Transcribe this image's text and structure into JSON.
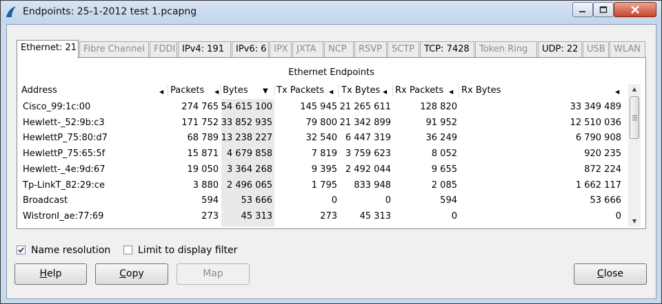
{
  "window": {
    "title": "Endpoints: 25-1-2012 test 1.pcapng"
  },
  "tabs": [
    {
      "label": "Ethernet: 21",
      "active": true,
      "enabled": true
    },
    {
      "label": "Fibre Channel",
      "enabled": false
    },
    {
      "label": "FDDI",
      "enabled": false
    },
    {
      "label": "IPv4: 191",
      "enabled": true
    },
    {
      "label": "IPv6: 6",
      "enabled": true
    },
    {
      "label": "IPX",
      "enabled": false
    },
    {
      "label": "JXTA",
      "enabled": false
    },
    {
      "label": "NCP",
      "enabled": false
    },
    {
      "label": "RSVP",
      "enabled": false
    },
    {
      "label": "SCTP",
      "enabled": false
    },
    {
      "label": "TCP: 7428",
      "enabled": true
    },
    {
      "label": "Token Ring",
      "enabled": false
    },
    {
      "label": "UDP: 22",
      "enabled": true
    },
    {
      "label": "USB",
      "enabled": false
    },
    {
      "label": "WLAN",
      "enabled": false
    }
  ],
  "panel": {
    "title": "Ethernet Endpoints"
  },
  "table": {
    "columns": [
      "Address",
      "Packets",
      "Bytes",
      "Tx Packets",
      "Tx Bytes",
      "Rx Packets",
      "Rx Bytes"
    ],
    "sorted_column": "Bytes",
    "rows": [
      [
        "Cisco_99:1c:00",
        "274 765",
        "54 615 100",
        "145 945",
        "21 265 611",
        "128 820",
        "33 349 489"
      ],
      [
        "Hewlett-_52:9b:c3",
        "171 752",
        "33 852 935",
        "79 800",
        "21 342 899",
        "91 952",
        "12 510 036"
      ],
      [
        "HewlettP_75:80:d7",
        "68 789",
        "13 238 227",
        "32 540",
        "6 447 319",
        "36 249",
        "6 790 908"
      ],
      [
        "HewlettP_75:65:5f",
        "15 871",
        "4 679 858",
        "7 819",
        "3 759 623",
        "8 052",
        "920 235"
      ],
      [
        "Hewlett-_4e:9d:67",
        "19 050",
        "3 364 268",
        "9 395",
        "2 492 044",
        "9 655",
        "872 224"
      ],
      [
        "Tp-LinkT_82:29:ce",
        "3 880",
        "2 496 065",
        "1 795",
        "833 948",
        "2 085",
        "1 662 117"
      ],
      [
        "Broadcast",
        "594",
        "53 666",
        "0",
        "0",
        "594",
        "53 666"
      ],
      [
        "WistronI_ae:77:69",
        "273",
        "45 313",
        "273",
        "45 313",
        "0",
        "0"
      ]
    ]
  },
  "options": {
    "name_resolution": {
      "label": "Name resolution",
      "checked": true
    },
    "limit_filter": {
      "label": "Limit to display filter",
      "checked": false
    }
  },
  "buttons": {
    "help": {
      "label": "Help",
      "mnemonic": "H",
      "rest": "elp"
    },
    "copy": {
      "label": "Copy",
      "mnemonic": "C",
      "rest": "opy"
    },
    "map": {
      "label": "Map"
    },
    "close": {
      "label": "Close",
      "mnemonic": "C",
      "rest": "lose"
    }
  },
  "colors": {
    "titlebar": "#c9d9ee",
    "close_button": "#c9452e",
    "sorted_column_bg": "#e9e9e9"
  }
}
